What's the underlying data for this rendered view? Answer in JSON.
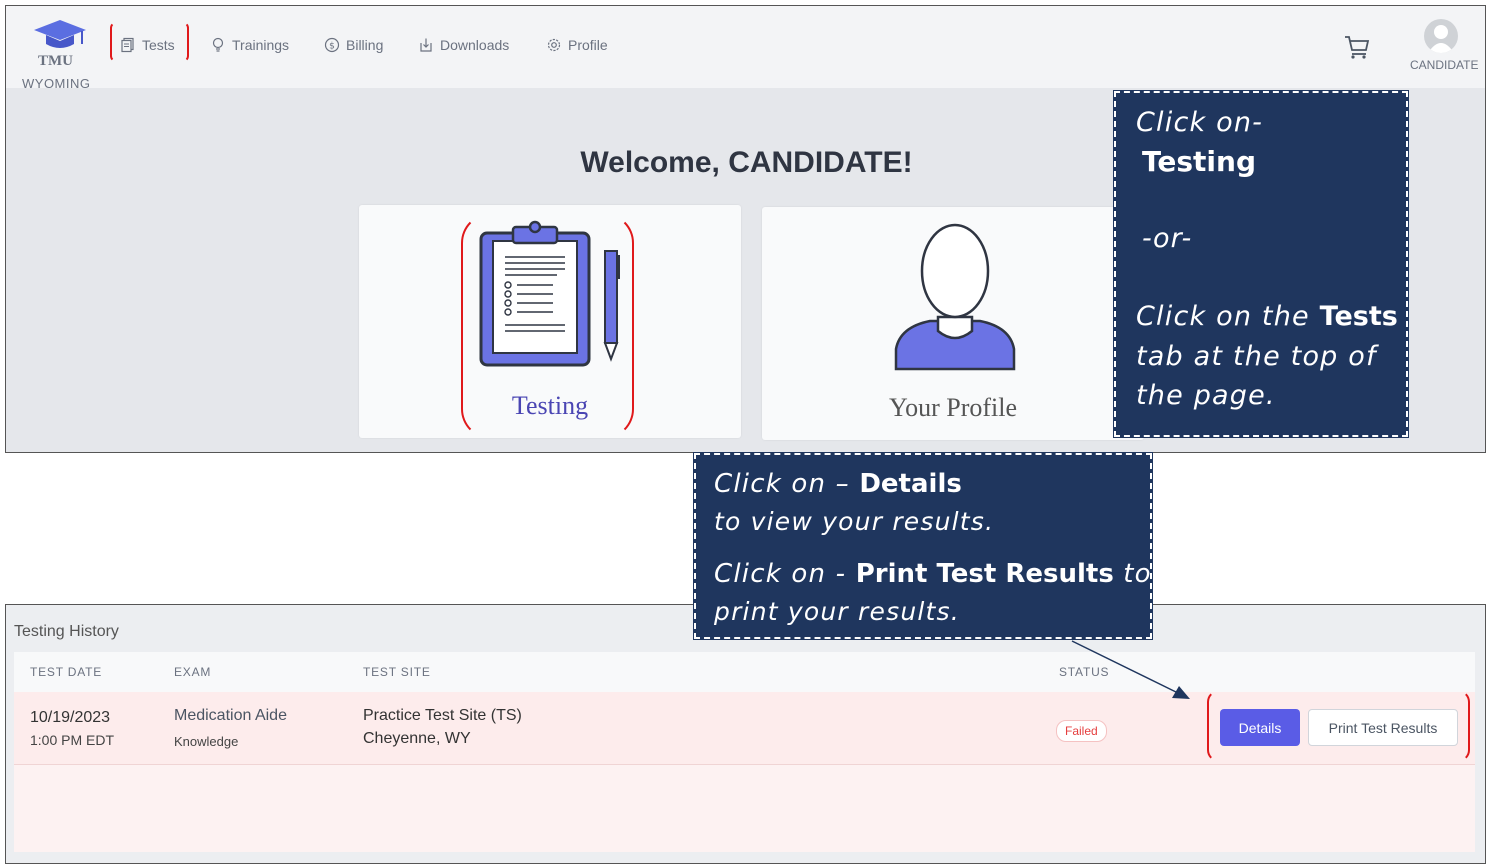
{
  "brand": {
    "line1": "TMU",
    "line2": "WYOMING"
  },
  "nav": {
    "tests": "Tests",
    "trainings": "Trainings",
    "billing": "Billing",
    "downloads": "Downloads",
    "profile": "Profile"
  },
  "user": {
    "name": "CANDIDATE"
  },
  "welcome": "Welcome, CANDIDATE!",
  "cards": {
    "testing": "Testing",
    "profile": "Your Profile"
  },
  "callout_top": {
    "line1": "Click on-",
    "line2": "Testing",
    "line3": "-or-",
    "line4_a": "Click on the ",
    "line4_b": "Tests",
    "line5": "tab at the top of",
    "line6": "the page."
  },
  "callout_bottom": {
    "a1": "Click on – ",
    "a2": "Details",
    "a3": "to view your results.",
    "b1": "Click on - ",
    "b2": "Print Test Results",
    "b3": " to",
    "b4": "print your results."
  },
  "history": {
    "title": "Testing History",
    "columns": [
      "TEST DATE",
      "EXAM",
      "TEST SITE",
      "STATUS"
    ],
    "rows": [
      {
        "date": "10/19/2023",
        "time": "1:00 PM EDT",
        "exam": "Medication Aide",
        "exam_type": "Knowledge",
        "site": "Practice Test Site (TS)",
        "city": "Cheyenne, WY",
        "status": "Failed",
        "details_label": "Details",
        "print_label": "Print Test Results"
      }
    ]
  },
  "colors": {
    "accent": "#5a5ce6",
    "callout": "#1f365e",
    "highlight": "#e0191b",
    "failed": "#e53e3e"
  }
}
